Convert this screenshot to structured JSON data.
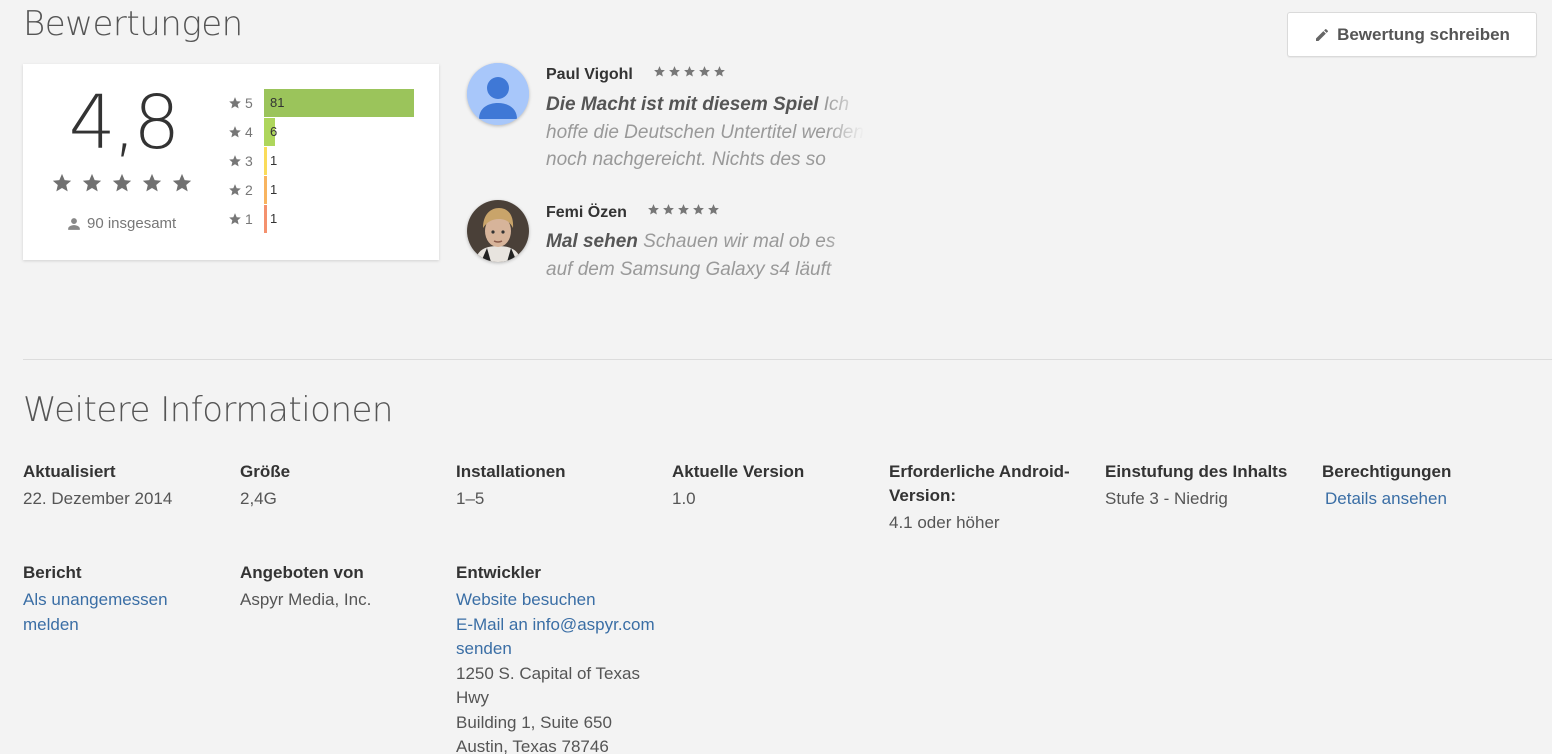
{
  "ratings": {
    "title": "Bewertungen",
    "write_review_label": "Bewertung schreiben",
    "score": "4,8",
    "total_label": "90 insgesamt",
    "histogram": [
      {
        "stars": "5",
        "count": "81",
        "fraction": 1.0,
        "color": "#9bc45b"
      },
      {
        "stars": "4",
        "count": "6",
        "fraction": 0.074,
        "color": "#aed65c"
      },
      {
        "stars": "3",
        "count": "1",
        "fraction": 0.012,
        "color": "#fadc5a"
      },
      {
        "stars": "2",
        "count": "1",
        "fraction": 0.012,
        "color": "#f8b45f"
      },
      {
        "stars": "1",
        "count": "1",
        "fraction": 0.012,
        "color": "#f4916e"
      }
    ]
  },
  "reviews": [
    {
      "author": "Paul Vigohl",
      "title": "Die Macht ist mit diesem Spiel",
      "text": "Ich hoffe die Deutschen Untertitel werden noch nachgereicht. Nichts des so trotz"
    },
    {
      "author": "Femi Özen",
      "title": "Mal sehen",
      "text": "Schauen wir mal ob es auf dem Samsung Galaxy s4 läuft"
    }
  ],
  "info": {
    "title": "Weitere Informationen",
    "updated": {
      "label": "Aktualisiert",
      "value": "22. Dezember 2014"
    },
    "size": {
      "label": "Größe",
      "value": "2,4G"
    },
    "installs": {
      "label": "Installationen",
      "value": "1–5"
    },
    "version": {
      "label": "Aktuelle Version",
      "value": "1.0"
    },
    "android": {
      "label": "Erforderliche Android-Version:",
      "value": "4.1 oder höher"
    },
    "rating": {
      "label": "Einstufung des Inhalts",
      "value": "Stufe 3 - Niedrig"
    },
    "permissions": {
      "label": "Berechtigungen",
      "link": "Details ansehen"
    },
    "report": {
      "label": "Bericht",
      "link": "Als unangemessen melden"
    },
    "offered_by": {
      "label": "Angeboten von",
      "value": "Aspyr Media, Inc."
    },
    "developer": {
      "label": "Entwickler",
      "website_link": "Website besuchen",
      "email_link": "E-Mail an info@aspyr.com senden",
      "address_line1": "1250 S. Capital of Texas Hwy",
      "address_line2": "Building 1, Suite 650",
      "address_line3": "Austin, Texas 78746"
    }
  },
  "colors": {
    "link": "#3a6ea5",
    "star": "#707070"
  }
}
